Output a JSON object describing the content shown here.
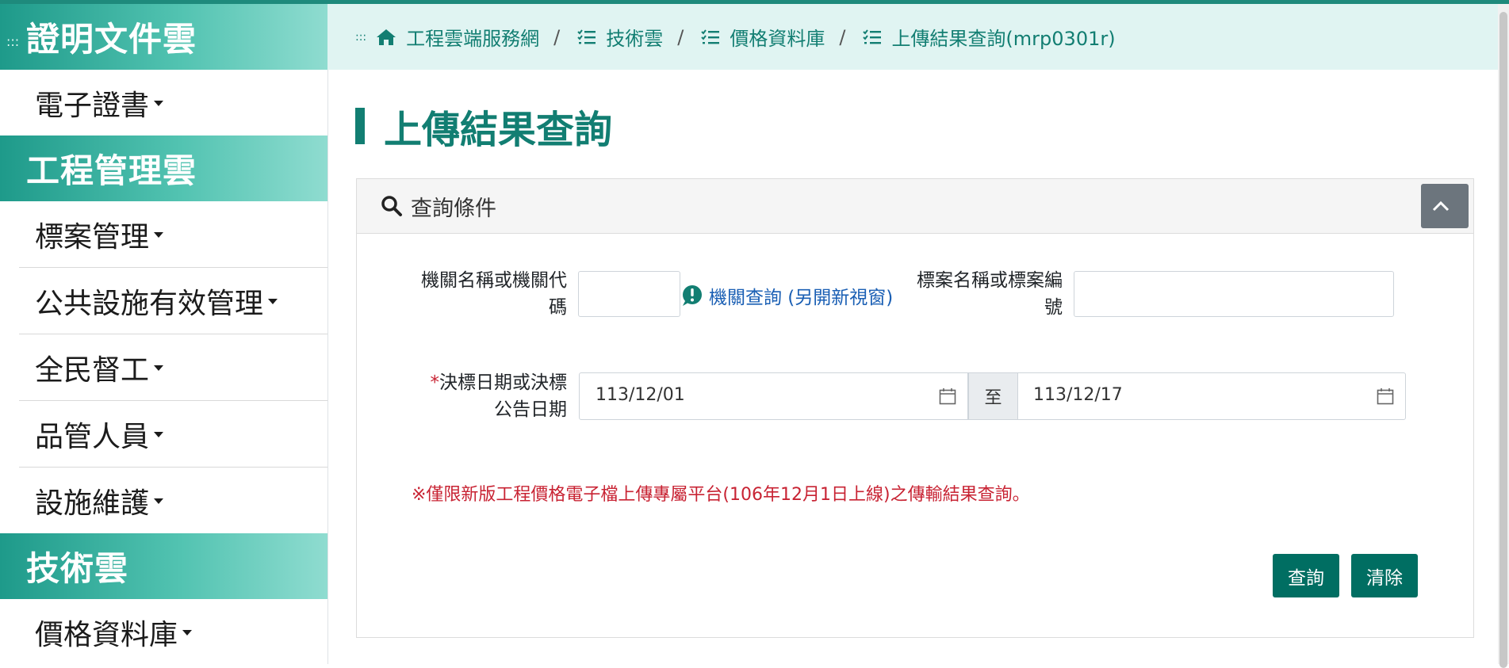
{
  "sidebar": {
    "sections": [
      {
        "title": "證明文件雲",
        "items": [
          "電子證書"
        ]
      },
      {
        "title": "工程管理雲",
        "items": [
          "標案管理",
          "公共設施有效管理",
          "全民督工",
          "品管人員",
          "設施維護"
        ]
      },
      {
        "title": "技術雲",
        "items": [
          "價格資料庫"
        ]
      }
    ],
    "skip_marker": ":::"
  },
  "breadcrumb": {
    "skip_marker": ":::",
    "items": [
      {
        "label": "工程雲端服務網",
        "icon": "home-icon"
      },
      {
        "label": "技術雲",
        "icon": "list-icon"
      },
      {
        "label": "價格資料庫",
        "icon": "list-icon"
      },
      {
        "label": "上傳結果查詢(mrp0301r)",
        "icon": "list-icon"
      }
    ],
    "separator": "/"
  },
  "page": {
    "title": "上傳結果查詢"
  },
  "query": {
    "header": "查詢條件",
    "agency_label_1": "機關名稱或機關代",
    "agency_label_2": "碼",
    "agency_value": "",
    "agency_lookup": "機關查詢 (另開新視窗)",
    "tender_label_1": "標案名稱或標案編",
    "tender_label_2": "號",
    "tender_value": "",
    "required_mark": "*",
    "date_label_1": "決標日期或決標",
    "date_label_2": "公告日期",
    "date_from": "113/12/01",
    "date_to_label": "至",
    "date_to": "113/12/17",
    "notice": "※僅限新版工程價格電子檔上傳專屬平台(106年12月1日上線)之傳輸結果查詢。",
    "search_button": "查詢",
    "clear_button": "清除"
  },
  "colors": {
    "accent": "#127e72",
    "button": "#006e62",
    "notice": "#c82333",
    "link": "#1a5fb4"
  }
}
